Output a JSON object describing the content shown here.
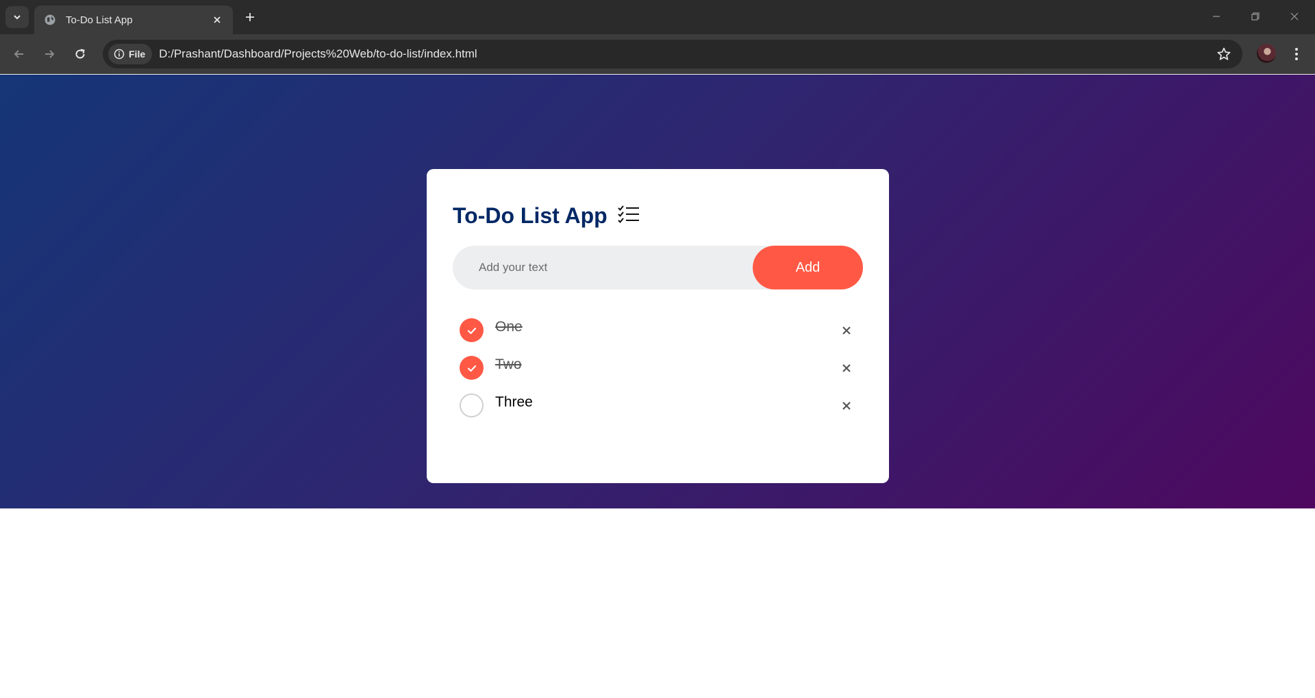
{
  "browser": {
    "tab_title": "To-Do List App",
    "chip_label": "File",
    "url": "D:/Prashant/Dashboard/Projects%20Web/to-do-list/index.html"
  },
  "app": {
    "title": "To-Do List App",
    "title_icon": "checklist-icon",
    "input": {
      "value": "",
      "placeholder": "Add your text"
    },
    "add_button_label": "Add",
    "tasks": [
      {
        "label": "One",
        "done": true
      },
      {
        "label": "Two",
        "done": true
      },
      {
        "label": "Three",
        "done": false
      }
    ]
  },
  "colors": {
    "accent": "#ff5945",
    "title": "#002765",
    "gradient_start": "#153677",
    "gradient_end": "#4e085f"
  }
}
